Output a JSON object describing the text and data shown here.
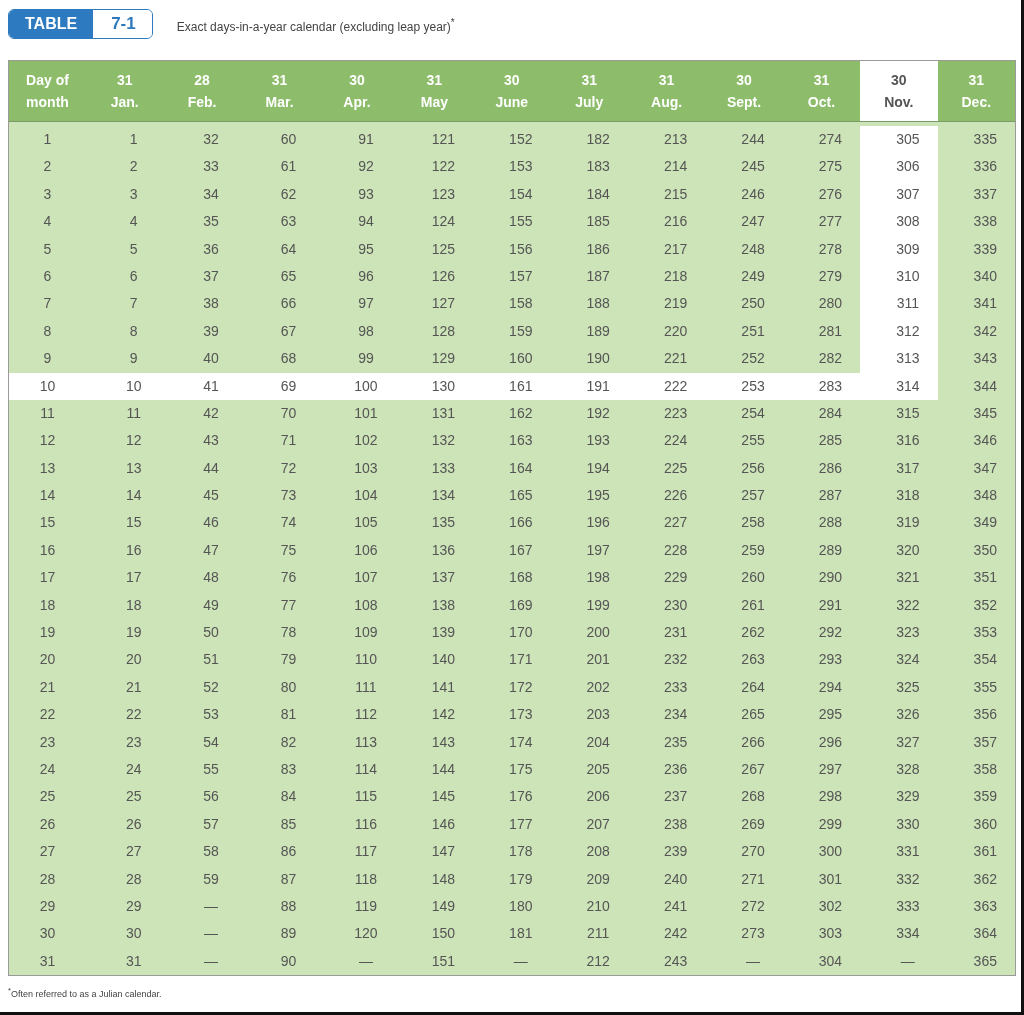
{
  "badge": {
    "label": "TABLE",
    "number": "7-1"
  },
  "title": "Exact days-in-a-year calendar (excluding leap year)$^{*}$",
  "first_column": "Day of month",
  "columns": [
    {
      "days": "31",
      "month": "Jan.",
      "selected": false
    },
    {
      "days": "28",
      "month": "Feb.",
      "selected": false
    },
    {
      "days": "31",
      "month": "Mar.",
      "selected": false
    },
    {
      "days": "30",
      "month": "Apr.",
      "selected": false
    },
    {
      "days": "31",
      "month": "May",
      "selected": false
    },
    {
      "days": "30",
      "month": "June",
      "selected": false
    },
    {
      "days": "31",
      "month": "July",
      "selected": false
    },
    {
      "days": "31",
      "month": "Aug.",
      "selected": false
    },
    {
      "days": "30",
      "month": "Sept.",
      "selected": false
    },
    {
      "days": "31",
      "month": "Oct.",
      "selected": false
    },
    {
      "days": "30",
      "month": "Nov.",
      "selected": true
    },
    {
      "days": "31",
      "month": "Dec.",
      "selected": false
    }
  ],
  "rows": [
    {
      "selected": false,
      "cells": [
        "1",
        "1",
        "32",
        "60",
        "91",
        "121",
        "152",
        "182",
        "213",
        "244",
        "274",
        "305",
        "335"
      ]
    },
    {
      "selected": false,
      "cells": [
        "2",
        "2",
        "33",
        "61",
        "92",
        "122",
        "153",
        "183",
        "214",
        "245",
        "275",
        "306",
        "336"
      ]
    },
    {
      "selected": false,
      "cells": [
        "3",
        "3",
        "34",
        "62",
        "93",
        "123",
        "154",
        "184",
        "215",
        "246",
        "276",
        "307",
        "337"
      ]
    },
    {
      "selected": false,
      "cells": [
        "4",
        "4",
        "35",
        "63",
        "94",
        "124",
        "155",
        "185",
        "216",
        "247",
        "277",
        "308",
        "338"
      ]
    },
    {
      "selected": false,
      "cells": [
        "5",
        "5",
        "36",
        "64",
        "95",
        "125",
        "156",
        "186",
        "217",
        "248",
        "278",
        "309",
        "339"
      ]
    },
    {
      "selected": false,
      "cells": [
        "6",
        "6",
        "37",
        "65",
        "96",
        "126",
        "157",
        "187",
        "218",
        "249",
        "279",
        "310",
        "340"
      ]
    },
    {
      "selected": false,
      "cells": [
        "7",
        "7",
        "38",
        "66",
        "97",
        "127",
        "158",
        "188",
        "219",
        "250",
        "280",
        "311",
        "341"
      ]
    },
    {
      "selected": false,
      "cells": [
        "8",
        "8",
        "39",
        "67",
        "98",
        "128",
        "159",
        "189",
        "220",
        "251",
        "281",
        "312",
        "342"
      ]
    },
    {
      "selected": false,
      "cells": [
        "9",
        "9",
        "40",
        "68",
        "99",
        "129",
        "160",
        "190",
        "221",
        "252",
        "282",
        "313",
        "343"
      ]
    },
    {
      "selected": true,
      "cells": [
        "10",
        "10",
        "41",
        "69",
        "100",
        "130",
        "161",
        "191",
        "222",
        "253",
        "283",
        "314",
        "344"
      ]
    },
    {
      "selected": false,
      "cells": [
        "11",
        "11",
        "42",
        "70",
        "101",
        "131",
        "162",
        "192",
        "223",
        "254",
        "284",
        "315",
        "345"
      ]
    },
    {
      "selected": false,
      "cells": [
        "12",
        "12",
        "43",
        "71",
        "102",
        "132",
        "163",
        "193",
        "224",
        "255",
        "285",
        "316",
        "346"
      ]
    },
    {
      "selected": false,
      "cells": [
        "13",
        "13",
        "44",
        "72",
        "103",
        "133",
        "164",
        "194",
        "225",
        "256",
        "286",
        "317",
        "347"
      ]
    },
    {
      "selected": false,
      "cells": [
        "14",
        "14",
        "45",
        "73",
        "104",
        "134",
        "165",
        "195",
        "226",
        "257",
        "287",
        "318",
        "348"
      ]
    },
    {
      "selected": false,
      "cells": [
        "15",
        "15",
        "46",
        "74",
        "105",
        "135",
        "166",
        "196",
        "227",
        "258",
        "288",
        "319",
        "349"
      ]
    },
    {
      "selected": false,
      "cells": [
        "16",
        "16",
        "47",
        "75",
        "106",
        "136",
        "167",
        "197",
        "228",
        "259",
        "289",
        "320",
        "350"
      ]
    },
    {
      "selected": false,
      "cells": [
        "17",
        "17",
        "48",
        "76",
        "107",
        "137",
        "168",
        "198",
        "229",
        "260",
        "290",
        "321",
        "351"
      ]
    },
    {
      "selected": false,
      "cells": [
        "18",
        "18",
        "49",
        "77",
        "108",
        "138",
        "169",
        "199",
        "230",
        "261",
        "291",
        "322",
        "352"
      ]
    },
    {
      "selected": false,
      "cells": [
        "19",
        "19",
        "50",
        "78",
        "109",
        "139",
        "170",
        "200",
        "231",
        "262",
        "292",
        "323",
        "353"
      ]
    },
    {
      "selected": false,
      "cells": [
        "20",
        "20",
        "51",
        "79",
        "110",
        "140",
        "171",
        "201",
        "232",
        "263",
        "293",
        "324",
        "354"
      ]
    },
    {
      "selected": false,
      "cells": [
        "21",
        "21",
        "52",
        "80",
        "111",
        "141",
        "172",
        "202",
        "233",
        "264",
        "294",
        "325",
        "355"
      ]
    },
    {
      "selected": false,
      "cells": [
        "22",
        "22",
        "53",
        "81",
        "112",
        "142",
        "173",
        "203",
        "234",
        "265",
        "295",
        "326",
        "356"
      ]
    },
    {
      "selected": false,
      "cells": [
        "23",
        "23",
        "54",
        "82",
        "113",
        "143",
        "174",
        "204",
        "235",
        "266",
        "296",
        "327",
        "357"
      ]
    },
    {
      "selected": false,
      "cells": [
        "24",
        "24",
        "55",
        "83",
        "114",
        "144",
        "175",
        "205",
        "236",
        "267",
        "297",
        "328",
        "358"
      ]
    },
    {
      "selected": false,
      "cells": [
        "25",
        "25",
        "56",
        "84",
        "115",
        "145",
        "176",
        "206",
        "237",
        "268",
        "298",
        "329",
        "359"
      ]
    },
    {
      "selected": false,
      "cells": [
        "26",
        "26",
        "57",
        "85",
        "116",
        "146",
        "177",
        "207",
        "238",
        "269",
        "299",
        "330",
        "360"
      ]
    },
    {
      "selected": false,
      "cells": [
        "27",
        "27",
        "58",
        "86",
        "117",
        "147",
        "178",
        "208",
        "239",
        "270",
        "300",
        "331",
        "361"
      ]
    },
    {
      "selected": false,
      "cells": [
        "28",
        "28",
        "59",
        "87",
        "118",
        "148",
        "179",
        "209",
        "240",
        "271",
        "301",
        "332",
        "362"
      ]
    },
    {
      "selected": false,
      "cells": [
        "29",
        "29",
        "—",
        "88",
        "119",
        "149",
        "180",
        "210",
        "241",
        "272",
        "302",
        "333",
        "363"
      ]
    },
    {
      "selected": false,
      "cells": [
        "30",
        "30",
        "—",
        "89",
        "120",
        "150",
        "181",
        "211",
        "242",
        "273",
        "303",
        "334",
        "364"
      ]
    },
    {
      "selected": false,
      "cells": [
        "31",
        "31",
        "—",
        "90",
        "—",
        "151",
        "—",
        "212",
        "243",
        "—",
        "304",
        "—",
        "365"
      ]
    }
  ],
  "footnote": "$^{*}$Often referred to as a Julian calendar."
}
